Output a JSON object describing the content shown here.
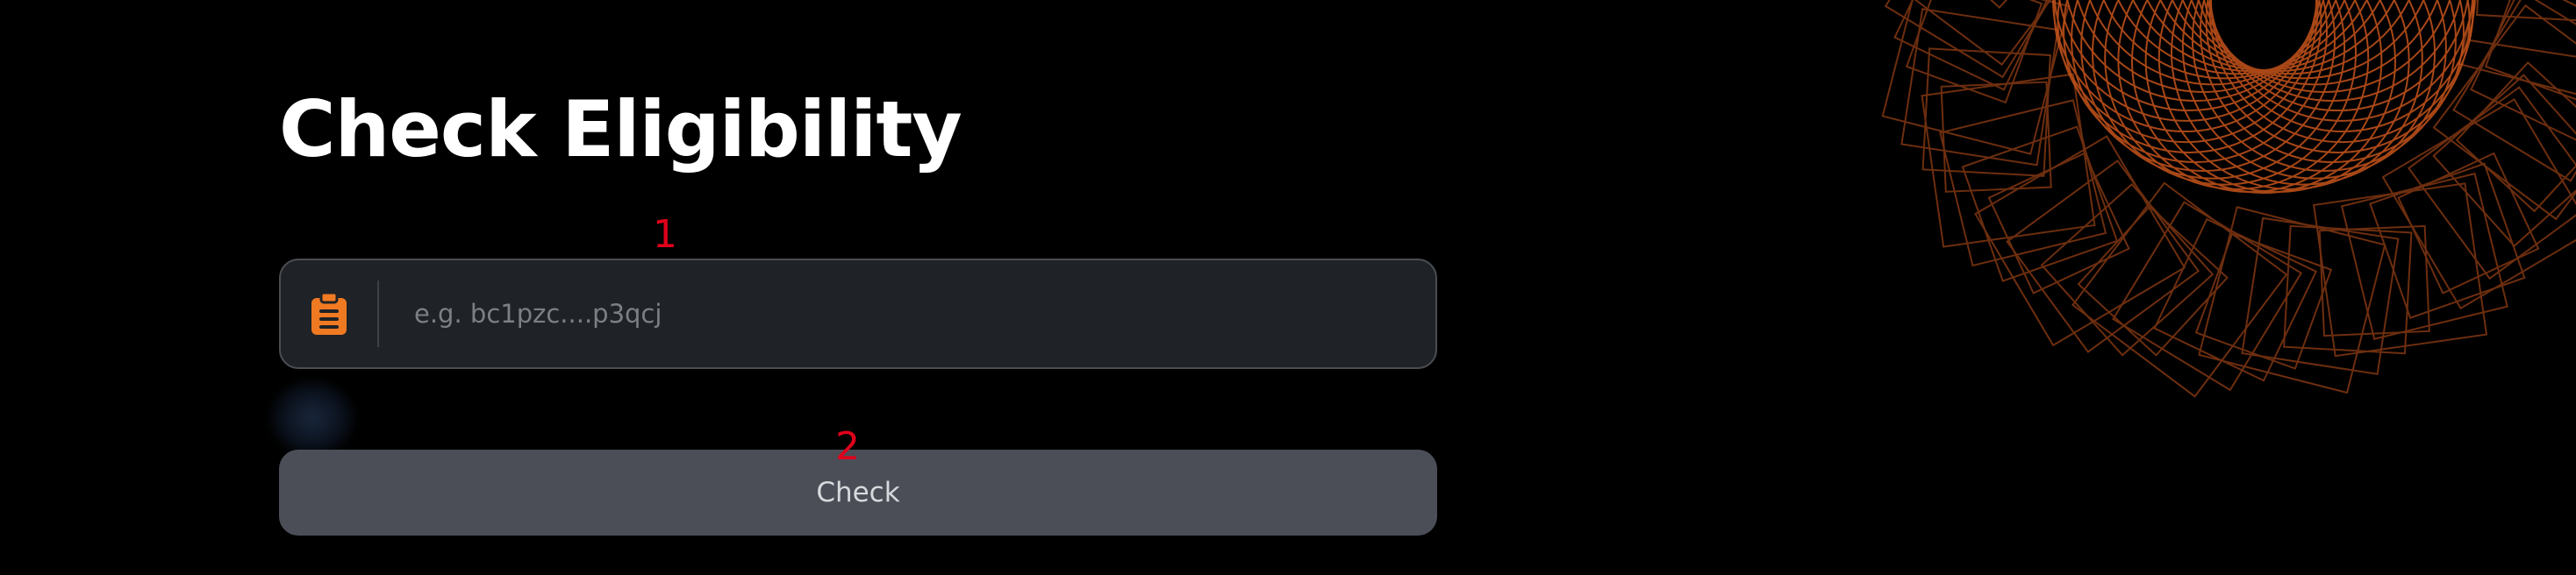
{
  "page": {
    "title": "Check Eligibility"
  },
  "markers": [
    "1",
    "2"
  ],
  "address_input": {
    "placeholder": "e.g. bc1pzc....p3qcj",
    "value": "",
    "icon": "clipboard-icon"
  },
  "check_button": {
    "label": "Check"
  },
  "colors": {
    "background": "#000000",
    "accent": "#f07a22",
    "decoration": "#c6541c",
    "button": "#4b4e57",
    "input_background": "#1f2226",
    "marker": "#e0001b"
  }
}
